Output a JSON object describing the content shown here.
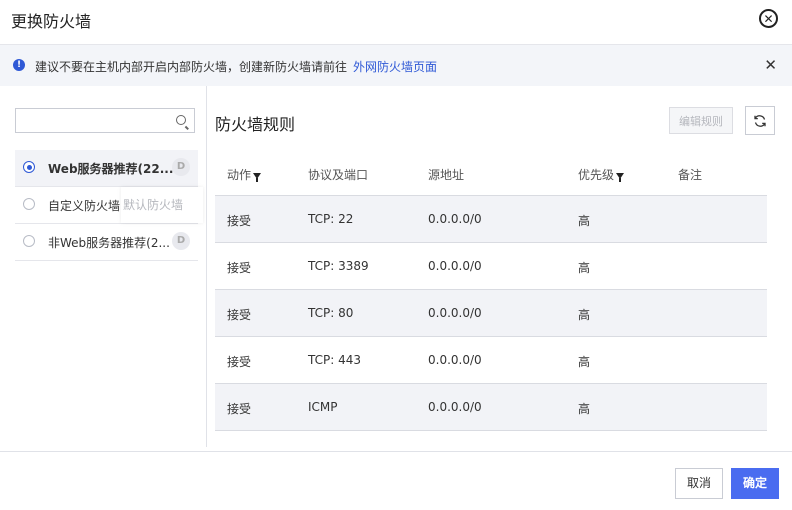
{
  "dialog": {
    "title": "更换防火墙"
  },
  "notice": {
    "text": "建议不要在主机内部开启内部防火墙，创建新防火墙请前往",
    "link": "外网防火墙页面",
    "icon": "info-icon"
  },
  "search": {
    "placeholder": "",
    "value": ""
  },
  "firewalls": [
    {
      "label": "Web服务器推荐(22...",
      "badge": "D",
      "selected": true
    },
    {
      "label": "自定义防火墙",
      "tooltip": "默认防火墙",
      "selected": false
    },
    {
      "label": "非Web服务器推荐(2...",
      "badge": "D",
      "selected": false
    }
  ],
  "rules": {
    "title": "防火墙规则",
    "edit_label": "编辑规则",
    "columns": [
      "动作",
      "协议及端口",
      "源地址",
      "优先级",
      "备注"
    ],
    "rows": [
      [
        "接受",
        "TCP: 22",
        "0.0.0.0/0",
        "高",
        ""
      ],
      [
        "接受",
        "TCP: 3389",
        "0.0.0.0/0",
        "高",
        ""
      ],
      [
        "接受",
        "TCP: 80",
        "0.0.0.0/0",
        "高",
        ""
      ],
      [
        "接受",
        "TCP: 443",
        "0.0.0.0/0",
        "高",
        ""
      ],
      [
        "接受",
        "ICMP",
        "0.0.0.0/0",
        "高",
        ""
      ]
    ]
  },
  "footer": {
    "cancel": "取消",
    "ok": "确定"
  },
  "colors": {
    "accent": "#2f59d6",
    "primary_button": "#4a6cf0"
  }
}
